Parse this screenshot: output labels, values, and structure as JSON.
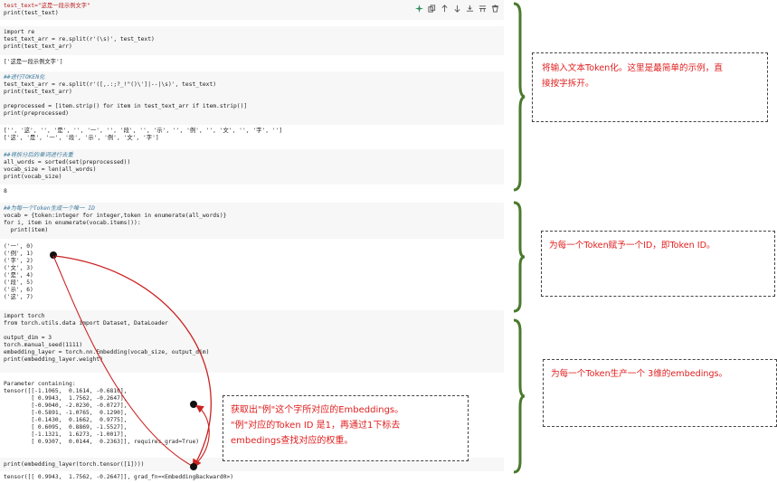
{
  "cells": [
    {
      "lines": [
        "test_text=\"这是一段示例文字\"",
        "print(test_text)"
      ]
    },
    {
      "lines": [
        "import re",
        "test_text_arr = re.split(r'(\\s)', test_text)",
        "print(test_text_arr)"
      ]
    },
    {
      "lines": [
        "##进行TOKEN化",
        "test_text_arr = re.split(r'([,.:;?_!\"()\\']|--|\\s)', test_text)",
        "print(test_text_arr)",
        "",
        "preprocessed = [item.strip() for item in test_text_arr if item.strip()]",
        "print(preprocessed)"
      ]
    },
    {
      "lines": [
        "##将拆分后的单词进行去重",
        "all_words = sorted(set(preprocessed))",
        "vocab_size = len(all_words)",
        "print(vocab_size)"
      ]
    },
    {
      "lines": [
        "##为每一个Token生成一个唯一 ID",
        "vocab = {token:integer for integer,token in enumerate(all_words)}",
        "for i, item in enumerate(vocab.items()):",
        "  print(item)"
      ]
    },
    {
      "lines": [
        "import torch",
        "from torch.utils.data import Dataset, DataLoader",
        "",
        "output_dim = 3",
        "torch.manual_seed(1111)",
        "embedding_layer = torch.nn.Embedding(vocab_size, output_dim)",
        "print(embedding_layer.weight)"
      ]
    },
    {
      "lines": [
        "print(embedding_layer(torch.tensor([1])))"
      ]
    }
  ],
  "outputs": [
    {
      "lines": [
        "['这是一段示例文字']"
      ]
    },
    {
      "lines": [
        "['', '这', '', '是', '', '一', '', '段', '', '示', '', '例', '', '文', '', '字', '']",
        "['这', '是', '一', '段', '示', '例', '文', '字']"
      ]
    },
    {
      "lines": [
        "8"
      ]
    },
    {
      "lines": [
        "('一', 0)",
        "('例', 1)",
        "('字', 2)",
        "('文', 3)",
        "('是', 4)",
        "('段', 5)",
        "('示', 6)",
        "('这', 7)"
      ]
    },
    {
      "lines": [
        "Parameter containing:",
        "tensor([[-1.1065,  0.1614, -0.6810],",
        "        [ 0.9943,  1.7562, -0.2647],",
        "        [-0.9040, -2.0230, -0.0727],",
        "        [-0.5891, -1.0765,  0.1290],",
        "        [-0.1430,  0.1662,  0.9775],",
        "        [ 0.6095,  0.8869, -1.5527],",
        "        [-1.1321,  1.6273, -1.0017],",
        "        [ 0.9307,  0.0144,  0.2363]], requires_grad=True)"
      ]
    },
    {
      "lines": [
        "tensor([[ 0.9943,  1.7562, -0.2647]], grad_fn=<EmbeddingBackward0>)"
      ]
    }
  ],
  "notes": {
    "note1": [
      "将输入文本Token化。这里是最简单的示例，直",
      "接按字拆开。"
    ],
    "note2": [
      "为每一个Token赋予一个ID，即Token ID。"
    ],
    "note3": [
      "为每一个Token生产一个 3维的embedings。"
    ],
    "note4": [
      "获取出\"例\"这个字所对应的Embeddings。",
      "\"例\"对应的Token ID 是1，再通过1下标去",
      "embedings查找对应的权重。"
    ]
  },
  "colors": {
    "annotation_text": "#e02020",
    "brace": "#4a7a2c",
    "arrow": "#cc2222"
  },
  "toolbar_icons": [
    "sparkle-icon",
    "copy-icon",
    "arrow-up-icon",
    "arrow-down-icon",
    "insert-icon",
    "split-icon",
    "trash-icon"
  ]
}
